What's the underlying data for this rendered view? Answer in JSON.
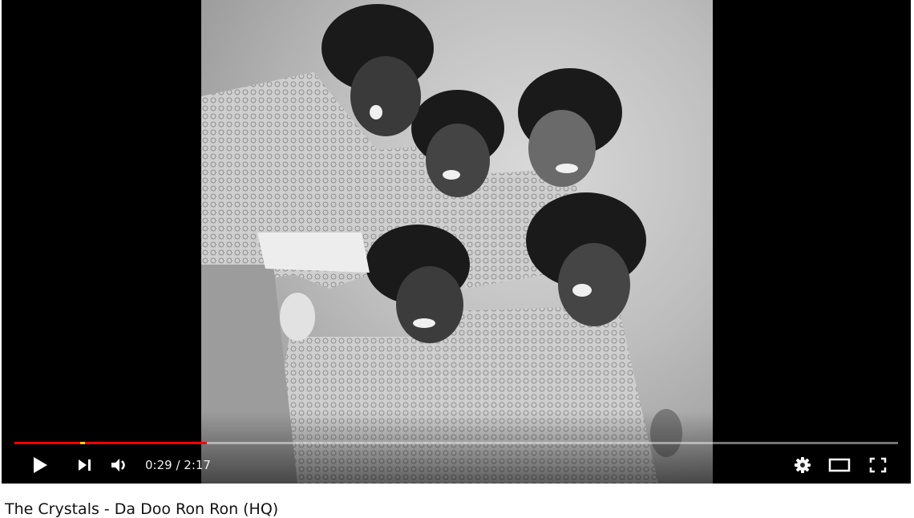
{
  "player": {
    "time_current": "0:29",
    "time_separator": " / ",
    "time_total": "2:17",
    "progress_played_fraction": 0.218,
    "progress_buffered_fraction": 0.218,
    "ad_marker_fraction": 0.074
  },
  "controls": {
    "play_icon": "play-icon",
    "next_icon": "skip-next-icon",
    "volume_icon": "volume-icon",
    "settings_icon": "gear-icon",
    "theater_icon": "theater-mode-icon",
    "fullscreen_icon": "fullscreen-icon"
  },
  "video": {
    "title": "The Crystals - Da Doo Ron Ron (HQ)"
  },
  "colors": {
    "progress_played": "#ff0000",
    "ad_marker": "#f2d600",
    "player_background": "#000000"
  }
}
